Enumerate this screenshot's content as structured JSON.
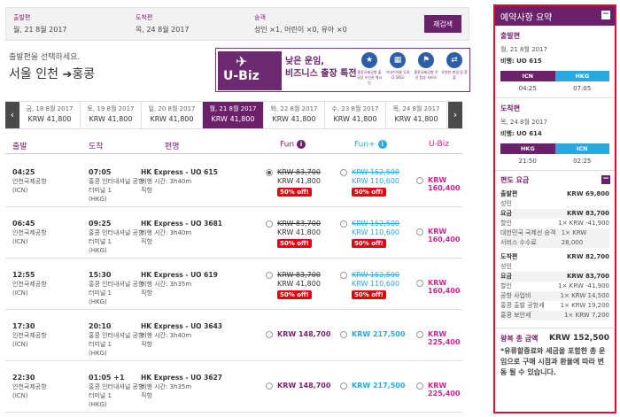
{
  "search": {
    "depart_label": "출발편",
    "depart_value": "월, 21 8월 2017",
    "arrive_label": "도착편",
    "arrive_value": "목, 24 8월 2017",
    "pax_label": "승객",
    "pax_value": "성인 ×1, 어린이 ×0, 유아 ×0",
    "research_label": "재검색"
  },
  "select_text": "출발편을 선택하세요.",
  "route": {
    "from": "서울 인천",
    "arrow": "➔",
    "to": "홍콩"
  },
  "banner": {
    "logo_text": "U-Biz",
    "title_line1": "낮은 운임,",
    "title_line2": "비즈니스 출장 특전",
    "icons": [
      {
        "name": "priority-checkin-icon",
        "glyph": "★",
        "text": "홍콩국제공항 출국장 우선권 체크인"
      },
      {
        "name": "baggage-allowance-icon",
        "glyph": "▦",
        "text": "기내수하물 무료 (2.5KG)"
      },
      {
        "name": "priority-boarding-icon",
        "glyph": "⚑",
        "text": "홍콩국제공항 우선 탑승 서비스"
      },
      {
        "name": "flexible-change-icon",
        "glyph": "⇄",
        "text": "유연한 변경 및 환불"
      }
    ]
  },
  "dates": [
    {
      "day": "금, 18 8월 2017",
      "price": "KRW 41,800"
    },
    {
      "day": "토, 19 8월 2017",
      "price": "KRW 41,800"
    },
    {
      "day": "일, 20 8월 2017",
      "price": "KRW 41,800"
    },
    {
      "day": "월, 21 8월 2017",
      "price": "KRW 41,800",
      "active": true
    },
    {
      "day": "화, 22 8월 2017",
      "price": "KRW 41,800"
    },
    {
      "day": "수, 23 8월 2017",
      "price": "KRW 41,800"
    },
    {
      "day": "목, 24 8월 2017",
      "price": "KRW 41,800"
    }
  ],
  "nav": {
    "prev": "‹",
    "next": "›"
  },
  "columns": {
    "depart": "출발",
    "arrive": "도착",
    "flight": "편명",
    "fun": "Fun",
    "funplus": "Fun+",
    "ubiz": "U-Biz",
    "info": "i"
  },
  "flights": [
    {
      "dep_time": "04:25",
      "dep_airport": "인천국제공항",
      "dep_code": "(ICN)",
      "arr_time": "07:05",
      "arr_airport": "홍콩 인터내셔널 공항",
      "arr_terminal": "터미널 1",
      "arr_code": "(HKG)",
      "flight": "HK Express - UO 615",
      "duration": "비행 시간: 3h40m",
      "type": "직항",
      "fun_old": "KRW 83,700",
      "fun_new": "KRW 41,800",
      "fun_badge": "50% off!",
      "fun_checked": true,
      "funp_old": "KRW 152,500",
      "funp_new": "KRW 110,600",
      "funp_badge": "50% off!",
      "ubiz": "KRW 160,400"
    },
    {
      "dep_time": "06:45",
      "dep_airport": "인천국제공항",
      "dep_code": "(ICN)",
      "arr_time": "09:25",
      "arr_airport": "홍콩 인터내셔널 공항",
      "arr_terminal": "터미널 1",
      "arr_code": "(HKG)",
      "flight": "HK Express - UO 3681",
      "duration": "비행 시간: 3h40m",
      "type": "직항",
      "fun_old": "KRW 83,700",
      "fun_new": "KRW 41,800",
      "fun_badge": "50% off!",
      "fun_checked": false,
      "funp_old": "KRW 152,500",
      "funp_new": "KRW 110,600",
      "funp_badge": "50% off!",
      "ubiz": "KRW 160,400"
    },
    {
      "dep_time": "12:55",
      "dep_airport": "인천국제공항",
      "dep_code": "(ICN)",
      "arr_time": "15:30",
      "arr_airport": "홍콩 인터내셔널 공항",
      "arr_terminal": "터미널 1",
      "arr_code": "(HKG)",
      "flight": "HK Express - UO 619",
      "duration": "비행 시간: 3h35m",
      "type": "직항",
      "fun_old": "KRW 83,700",
      "fun_new": "KRW 41,800",
      "fun_badge": "50% off!",
      "fun_checked": false,
      "funp_old": "KRW 152,500",
      "funp_new": "KRW 110,600",
      "funp_badge": "50% off!",
      "ubiz": "KRW 160,400"
    },
    {
      "dep_time": "17:30",
      "dep_airport": "인천국제공항",
      "dep_code": "(ICN)",
      "arr_time": "20:10",
      "arr_airport": "홍콩 인터내셔널 공항",
      "arr_terminal": "터미널 1",
      "arr_code": "(HKG)",
      "flight": "HK Express - UO 3643",
      "duration": "비행 시간: 3h40m",
      "type": "직항",
      "fun_old": "",
      "fun_new": "KRW 148,700",
      "fun_badge": "",
      "fun_checked": false,
      "funp_old": "",
      "funp_new": "KRW 217,500",
      "funp_badge": "",
      "ubiz": "KRW 225,400"
    },
    {
      "dep_time": "22:30",
      "dep_airport": "인천국제공항",
      "dep_code": "(ICN)",
      "arr_time": "01:05 +1",
      "arr_airport": "홍콩 인터내셔널 공항",
      "arr_terminal": "터미널 1",
      "arr_code": "(HKG)",
      "flight": "HK Express - UO 3627",
      "duration": "비행 시간: 3h35m",
      "type": "직항",
      "fun_old": "",
      "fun_new": "KRW 148,700",
      "fun_badge": "",
      "fun_checked": false,
      "funp_old": "",
      "funp_new": "KRW 217,500",
      "funp_badge": "",
      "ubiz": "KRW 225,400"
    }
  ],
  "summary": {
    "title": "예약사항 요약",
    "collapse": "−",
    "outbound": {
      "title": "출발편",
      "date": "월, 21 8월 2017",
      "flight": "비행: UO 615",
      "from": "ICN",
      "to": "HKG",
      "dep": "04:25",
      "arr": "07:05"
    },
    "inbound": {
      "title": "도착편",
      "date": "목, 24 8월 2017",
      "flight": "비행: UO 614",
      "from": "HKG",
      "to": "ICN",
      "dep": "21:50",
      "arr": "02:25"
    },
    "fare": {
      "title": "편도 요금",
      "out_label": "출발편",
      "out_total": "KRW 69,800",
      "out_pax": "성인",
      "out_fare_label": "요금",
      "out_fare": "KRW 83,700",
      "out_discount_label": "할인",
      "out_discount": "1× KRW -41,900",
      "out_fee_label": "대한민국 국제선 승객 서비스 수수료",
      "out_fee": "1× KRW 28,000",
      "in_label": "도착편",
      "in_total": "KRW 82,700",
      "in_pax": "성인",
      "in_fare_label": "요금",
      "in_fare": "KRW 83,700",
      "in_discount_label": "할인",
      "in_discount": "1× KRW -41,900",
      "in_fee1_label": "공항 사업비",
      "in_fee1": "1× KRW 14,500",
      "in_fee2_label": "홍콩 출발 공항세",
      "in_fee2": "1× KRW 19,200",
      "in_fee3_label": "홍콩 보안세",
      "in_fee3": "1× KRW 7,200"
    },
    "total_label": "왕복 총 금액",
    "total_value": "KRW 152,500",
    "note": "*유류할증료와 세금을 포함한 총 운임으로 구매 시점과 환율에 따라 변동 될 수 있습니다."
  },
  "colors": {
    "brand": "#6b2169",
    "funplus": "#27a8e0",
    "ubiz": "#d1248f",
    "badge": "#e60012",
    "highlight_border": "#e0102a"
  }
}
